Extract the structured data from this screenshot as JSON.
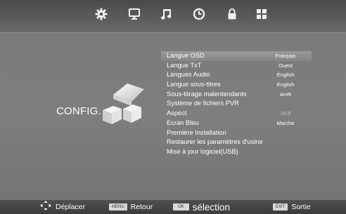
{
  "topbar": {
    "tabs": [
      {
        "icon": "gear-icon"
      },
      {
        "icon": "monitor-icon"
      },
      {
        "icon": "music-note-icon"
      },
      {
        "icon": "clock-icon"
      },
      {
        "icon": "lock-icon"
      },
      {
        "icon": "grid-icon"
      }
    ],
    "active_index": 0
  },
  "category": {
    "label": "CONFIG.",
    "icon": "config-blocks-icon"
  },
  "menu": {
    "selected_index": 0,
    "items": [
      {
        "label": "Langue OSD",
        "value": "Français"
      },
      {
        "label": "Langue TxT",
        "value": "Ouest"
      },
      {
        "label": "Langues Audio",
        "value": "English"
      },
      {
        "label": "Langue  sous-titres",
        "value": "English"
      },
      {
        "label": "Sous-titrage malentendants",
        "value": "Arrêt"
      },
      {
        "label": "Système de fichiers PVR",
        "value": ""
      },
      {
        "label": "Aspect",
        "value": "16:9"
      },
      {
        "label": "Ecran Bleu",
        "value": "Marche"
      },
      {
        "label": "Première Installation",
        "value": ""
      },
      {
        "label": "Restaurer les paramètres d'usine",
        "value": ""
      },
      {
        "label": "Mise à jour logiciel(USB)",
        "value": ""
      }
    ]
  },
  "bottom_hints": {
    "move": {
      "icon": "dpad-arrows-icon",
      "label": "Déplacer"
    },
    "back": {
      "key": "MENU",
      "label": "Retour"
    },
    "select": {
      "key": "OK",
      "label": "sélection"
    },
    "exit": {
      "key": "EXIT",
      "label": "Sortie"
    }
  },
  "colors": {
    "background": "#7b7b7b",
    "selected_row": "#909090",
    "text": "#ffffff"
  }
}
